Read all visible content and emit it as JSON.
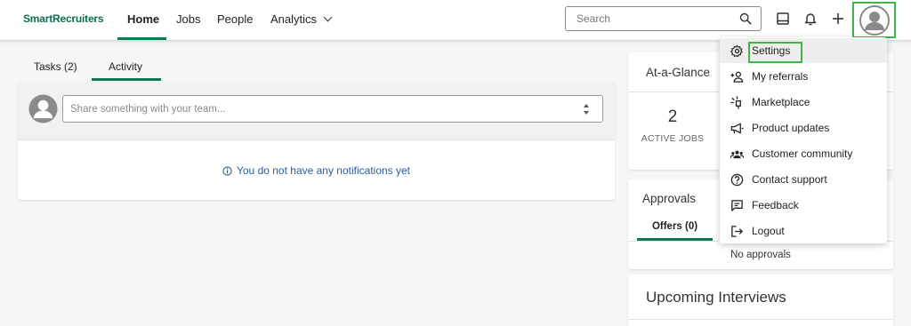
{
  "brand": {
    "logo_text": "SmartRecruiters",
    "accent_color": "#0b7a4f",
    "highlight_color": "#3cb54a"
  },
  "nav": {
    "home": "Home",
    "jobs": "Jobs",
    "people": "People",
    "analytics": "Analytics"
  },
  "search": {
    "placeholder": "Search"
  },
  "left": {
    "tabs": {
      "tasks": "Tasks (2)",
      "activity": "Activity"
    },
    "share_placeholder": "Share something with your team...",
    "empty_notice": "You do not have any notifications yet"
  },
  "glance": {
    "title": "At-a-Glance",
    "active_jobs_count": "2",
    "active_jobs_label": "ACTIVE JOBS"
  },
  "approvals": {
    "title": "Approvals",
    "tab_offers": "Offers (0)",
    "empty": "No approvals"
  },
  "interviews": {
    "title": "Upcoming Interviews"
  },
  "menu": {
    "items": [
      {
        "label": "Settings",
        "icon": "gear-icon"
      },
      {
        "label": "My referrals",
        "icon": "add-person-icon"
      },
      {
        "label": "Marketplace",
        "icon": "plug-icon"
      },
      {
        "label": "Product updates",
        "icon": "megaphone-icon"
      },
      {
        "label": "Customer community",
        "icon": "group-icon"
      },
      {
        "label": "Contact support",
        "icon": "help-icon"
      },
      {
        "label": "Feedback",
        "icon": "feedback-icon"
      },
      {
        "label": "Logout",
        "icon": "logout-icon"
      }
    ]
  }
}
